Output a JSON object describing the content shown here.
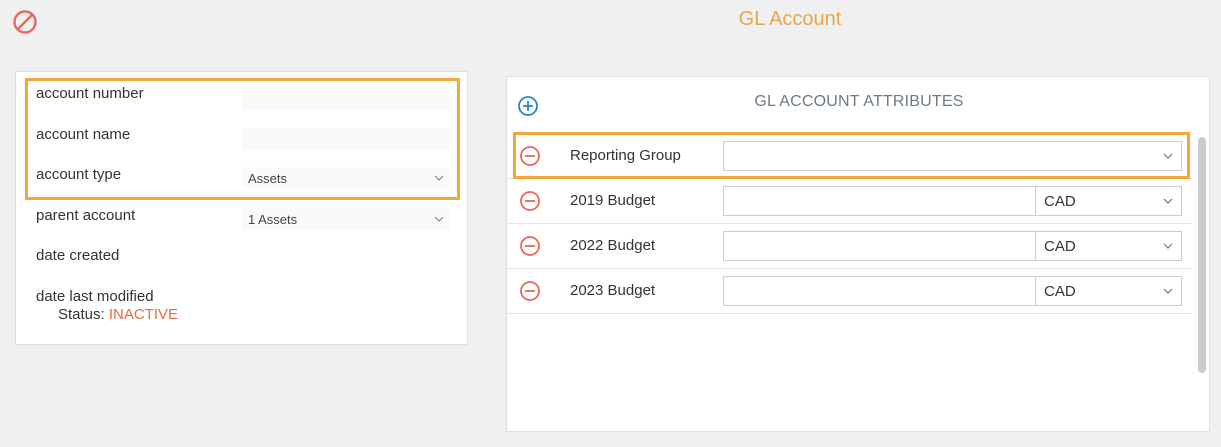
{
  "header": {
    "title": "GL Account",
    "cancel_icon": "cancel-icon",
    "accent_color": "#e8a64a"
  },
  "account_form": {
    "account_number": {
      "label": "account number",
      "value": ""
    },
    "account_name": {
      "label": "account name",
      "value": ""
    },
    "account_type": {
      "label": "account type",
      "value": "Assets"
    },
    "parent_account": {
      "label": "parent account",
      "value": "1 Assets"
    },
    "date_created": {
      "label": "date created",
      "value": ""
    },
    "date_last_modified": {
      "label": "date last modified",
      "value": ""
    },
    "status": {
      "label": "Status:",
      "value": "INACTIVE",
      "color": "#e86b3d"
    }
  },
  "attributes": {
    "title": "GL ACCOUNT ATTRIBUTES",
    "add_icon": "plus-circle-icon",
    "rows": [
      {
        "label": "Reporting Group",
        "value": "",
        "currency": null
      },
      {
        "label": "2019 Budget",
        "value": "",
        "currency": "CAD"
      },
      {
        "label": "2022 Budget",
        "value": "",
        "currency": "CAD"
      },
      {
        "label": "2023 Budget",
        "value": "",
        "currency": "CAD"
      }
    ]
  },
  "highlight_color": "#f2a93b"
}
